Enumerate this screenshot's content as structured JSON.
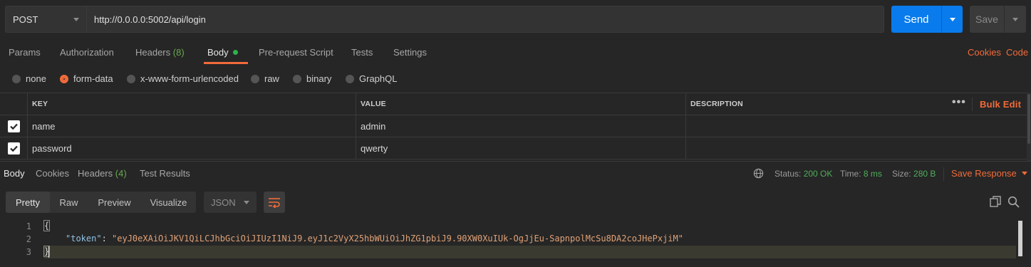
{
  "request": {
    "method": "POST",
    "url": "http://0.0.0.0:5002/api/login",
    "send_label": "Send",
    "save_label": "Save"
  },
  "tabs": {
    "params": "Params",
    "authorization": "Authorization",
    "headers": "Headers",
    "headers_count": "(8)",
    "body": "Body",
    "prerequest": "Pre-request Script",
    "tests": "Tests",
    "settings": "Settings",
    "cookies": "Cookies",
    "code": "Code"
  },
  "body_types": {
    "none": "none",
    "form_data": "form-data",
    "urlencoded": "x-www-form-urlencoded",
    "raw": "raw",
    "binary": "binary",
    "graphql": "GraphQL",
    "selected": "form-data"
  },
  "kv_table": {
    "headers": {
      "key": "KEY",
      "value": "VALUE",
      "description": "DESCRIPTION"
    },
    "bulk_edit": "Bulk Edit",
    "more": "•••",
    "rows": [
      {
        "key": "name",
        "value": "admin",
        "description": "",
        "checked": true
      },
      {
        "key": "password",
        "value": "qwerty",
        "description": "",
        "checked": true
      }
    ]
  },
  "response": {
    "tabs": {
      "body": "Body",
      "cookies": "Cookies",
      "headers": "Headers",
      "headers_count": "(4)",
      "test_results": "Test Results"
    },
    "status_label": "Status:",
    "status_value": "200 OK",
    "time_label": "Time:",
    "time_value": "8 ms",
    "size_label": "Size:",
    "size_value": "280 B",
    "save_response": "Save Response"
  },
  "viewer": {
    "modes": {
      "pretty": "Pretty",
      "raw": "Raw",
      "preview": "Preview",
      "visualize": "Visualize"
    },
    "selected_mode": "Pretty",
    "format": "JSON",
    "lines": [
      {
        "num": "1",
        "text": "{"
      },
      {
        "num": "2",
        "key": "\"token\"",
        "sep": ": ",
        "value": "\"eyJ0eXAiOiJKV1QiLCJhbGciOiJIUzI1NiJ9.eyJ1c2VyX25hbWUiOiJhZG1pbiJ9.90XW0XuIUk-OgJjEu-SapnpolMcSu8DA2coJHePxjiM\""
      },
      {
        "num": "3",
        "text": "}"
      }
    ]
  },
  "colors": {
    "accent": "#f26b3a",
    "send": "#097bed",
    "success": "#4fae5a"
  }
}
